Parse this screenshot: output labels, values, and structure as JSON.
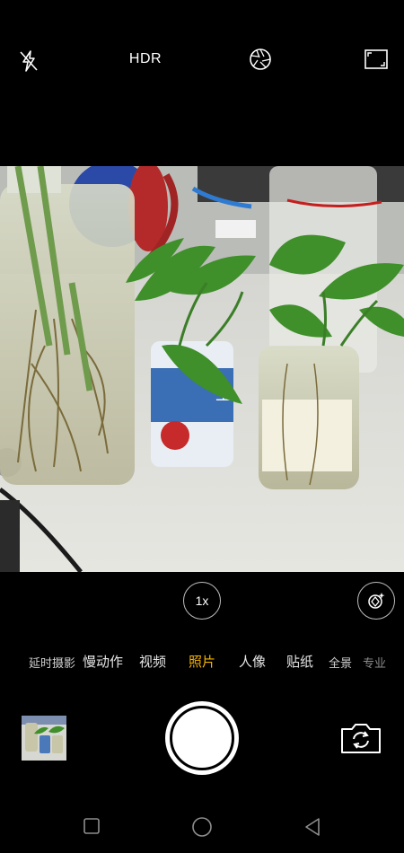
{
  "top_bar": {
    "flash_icon": "flash-off-icon",
    "hdr_label": "HDR",
    "filter_icon": "aperture-icon",
    "aspect_icon": "aspect-ratio-icon"
  },
  "zoom": {
    "label": "1x"
  },
  "lens_icon": "lens-filter-icon",
  "modes": [
    {
      "label": "延时摄影"
    },
    {
      "label": "慢动作"
    },
    {
      "label": "视频"
    },
    {
      "label": "照片"
    },
    {
      "label": "人像"
    },
    {
      "label": "贴纸"
    },
    {
      "label": "全景"
    },
    {
      "label": "专业"
    }
  ],
  "active_mode": "照片",
  "colors": {
    "accent": "#f5b400",
    "background": "#000000"
  },
  "bottom": {
    "gallery_icon": "gallery-thumbnail",
    "shutter_icon": "shutter-button",
    "switch_icon": "switch-camera-icon"
  },
  "nav": {
    "recent_icon": "recent-apps-icon",
    "home_icon": "home-icon",
    "back_icon": "back-icon"
  }
}
